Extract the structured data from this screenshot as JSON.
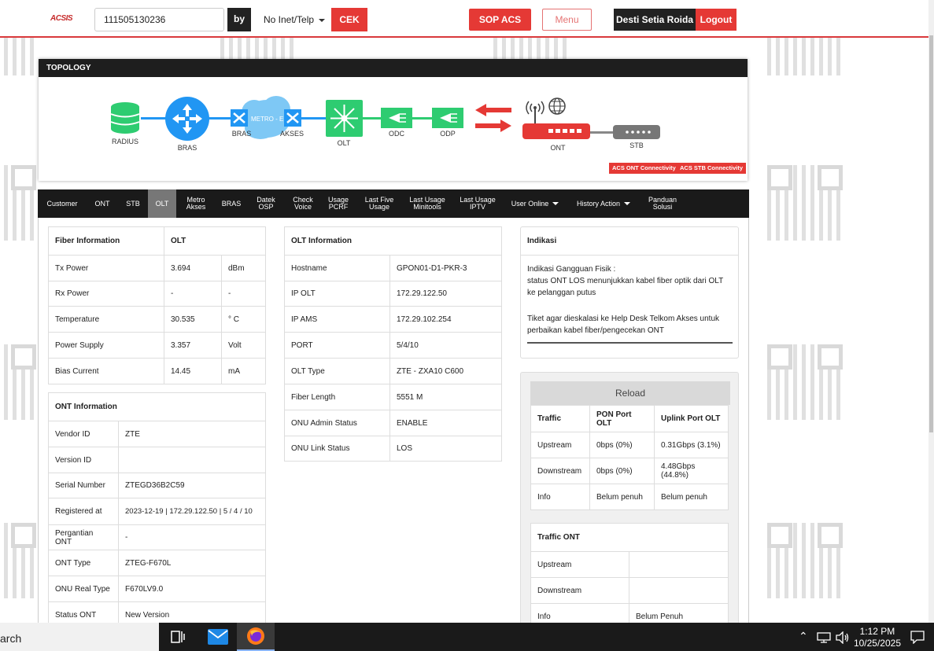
{
  "header": {
    "logo": "ACSIS",
    "search_value": "111505130236",
    "by_label": "by",
    "search_type": "No Inet/Telp",
    "cek_label": "CEK",
    "sop_label": "SOP ACS",
    "menu_label": "Menu",
    "user_name": "Desti Setia Roida",
    "logout_label": "Logout"
  },
  "topology": {
    "title": "TOPOLOGY",
    "nodes": {
      "radius": "RADIUS",
      "bras": "BRAS",
      "bras2": "BRAS",
      "metro": "METRO - E",
      "akses": "AKSES",
      "olt": "OLT",
      "odc": "ODC",
      "odp": "ODP",
      "ont": "ONT",
      "stb": "STB"
    },
    "acs_ont_btn": "ACS ONT Connectivity",
    "acs_stb_btn": "ACS STB Connectivity"
  },
  "tabs": [
    {
      "l1": "Customer",
      "l2": ""
    },
    {
      "l1": "ONT",
      "l2": ""
    },
    {
      "l1": "STB",
      "l2": ""
    },
    {
      "l1": "OLT",
      "l2": ""
    },
    {
      "l1": "Metro",
      "l2": "Akses"
    },
    {
      "l1": "BRAS",
      "l2": ""
    },
    {
      "l1": "Datek",
      "l2": "OSP"
    },
    {
      "l1": "Check",
      "l2": "Voice"
    },
    {
      "l1": "Usage",
      "l2": "PCRF"
    },
    {
      "l1": "Last Five",
      "l2": "Usage"
    },
    {
      "l1": "Last Usage",
      "l2": "Minitools"
    },
    {
      "l1": "Last Usage",
      "l2": "IPTV"
    },
    {
      "l1": "User Online",
      "l2": ""
    },
    {
      "l1": "History Action",
      "l2": ""
    },
    {
      "l1": "Panduan",
      "l2": "Solusi"
    }
  ],
  "fiber": {
    "h1": "Fiber Information",
    "h2": "OLT",
    "rows": [
      [
        "Tx Power",
        "3.694",
        "dBm"
      ],
      [
        "Rx Power",
        "-",
        "-"
      ],
      [
        "Temperature",
        "30.535",
        "° C"
      ],
      [
        "Power Supply",
        "3.357",
        "Volt"
      ],
      [
        "Bias Current",
        "14.45",
        "mA"
      ]
    ]
  },
  "ont": {
    "title": "ONT Information",
    "rows": [
      [
        "Vendor ID",
        "ZTE"
      ],
      [
        "Version ID",
        ""
      ],
      [
        "Serial Number",
        "ZTEGD36B2C59"
      ],
      [
        "Registered at",
        "2023-12-19 | 172.29.122.50 | 5 / 4 / 10"
      ],
      [
        "Pergantian ONT",
        "-"
      ],
      [
        "ONT Type",
        "ZTEG-F670L"
      ],
      [
        "ONU Real Type",
        "F670LV9.0"
      ],
      [
        "Status ONT",
        "New Version"
      ]
    ]
  },
  "olt": {
    "title": "OLT Information",
    "rows": [
      [
        "Hostname",
        "GPON01-D1-PKR-3"
      ],
      [
        "IP OLT",
        "172.29.122.50"
      ],
      [
        "IP AMS",
        "172.29.102.254"
      ],
      [
        "PORT",
        "5/4/10"
      ],
      [
        "OLT Type",
        "ZTE - ZXA10 C600"
      ],
      [
        "Fiber Length",
        "5551 M"
      ],
      [
        "ONU Admin Status",
        "ENABLE"
      ],
      [
        "ONU Link Status",
        "LOS"
      ]
    ]
  },
  "indikasi": {
    "title": "Indikasi",
    "line1": "Indikasi Gangguan Fisik :",
    "line2": "status ONT LOS menunjukkan kabel fiber optik dari OLT ke pelanggan putus",
    "line3": "Tiket agar dieskalasi ke Help Desk Telkom Akses untuk perbaikan kabel fiber/pengecekan ONT"
  },
  "traffic": {
    "reload": "Reload",
    "headers": [
      "Traffic",
      "PON Port OLT",
      "Uplink Port OLT"
    ],
    "rows": [
      [
        "Upstream",
        "0bps (0%)",
        "0.31Gbps (3.1%)"
      ],
      [
        "Downstream",
        "0bps (0%)",
        "4.48Gbps (44.8%)"
      ],
      [
        "Info",
        "Belum penuh",
        "Belum penuh"
      ]
    ]
  },
  "traffic_ont": {
    "title": "Traffic ONT",
    "rows": [
      [
        "Upstream",
        ""
      ],
      [
        "Downstream",
        ""
      ],
      [
        "Info",
        "Belum Penuh"
      ]
    ]
  },
  "taskbar": {
    "search": "arch",
    "time": "1:12 PM",
    "date": "10/25/2025"
  },
  "colors": {
    "accent_red": "#e53935",
    "dark": "#1a1a1a",
    "topo_blue": "#2196f3",
    "topo_green": "#2ecc71"
  }
}
